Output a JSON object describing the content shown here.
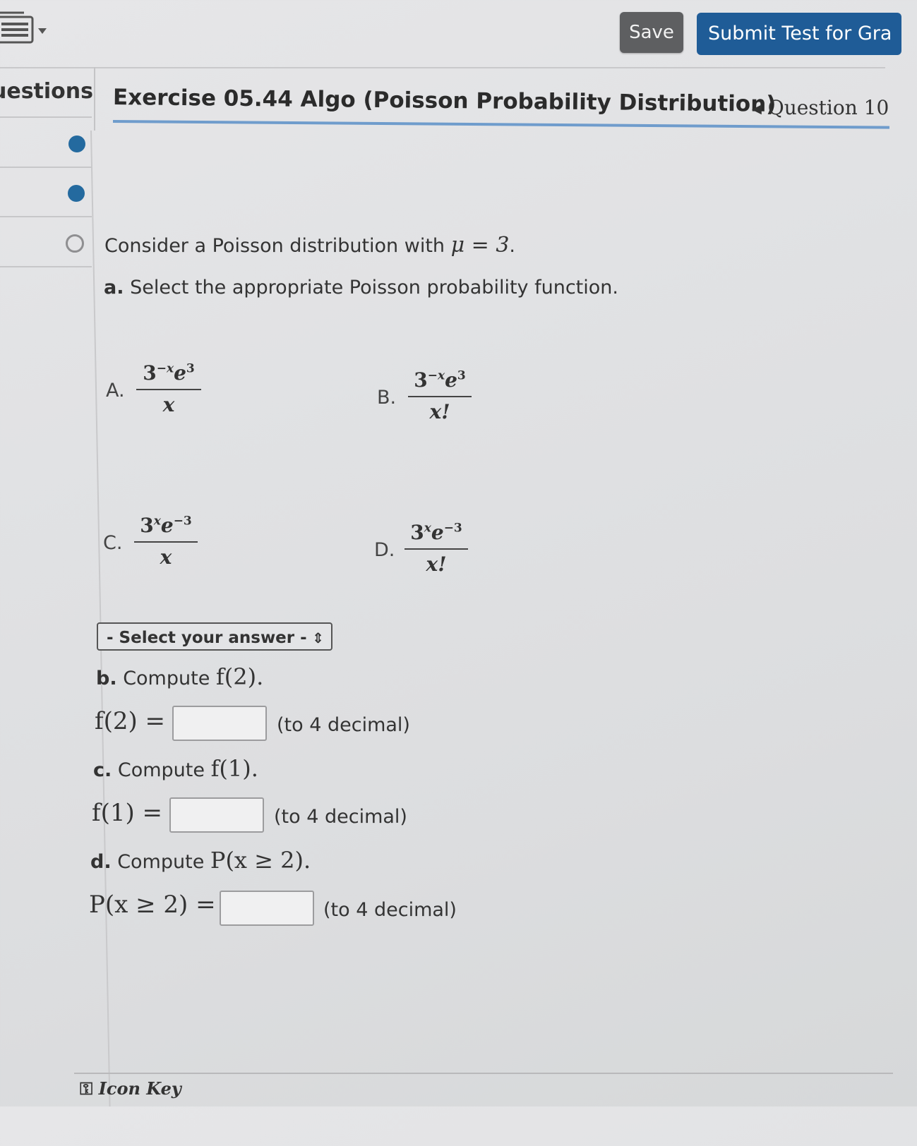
{
  "toolbar": {
    "save_label": "Save",
    "submit_label": "Submit Test for Gra"
  },
  "sidebar": {
    "header": "uestions",
    "items": [
      {
        "status": "answered"
      },
      {
        "status": "answered"
      },
      {
        "status": "unanswered"
      }
    ]
  },
  "exercise": {
    "title": "Exercise 05.44 Algo (Poisson Probability Distribution)",
    "nav_label": "Question 10"
  },
  "question": {
    "intro_text": "Consider a Poisson distribution with ",
    "intro_math": "μ = 3",
    "intro_end": ".",
    "part_a_label": "a.",
    "part_a_text": "Select the appropriate Poisson probability function.",
    "options": [
      {
        "letter": "A.",
        "num_base": "3",
        "num_exp1": "−x",
        "num_e": "e",
        "num_exp2": "3",
        "den": "x"
      },
      {
        "letter": "B.",
        "num_base": "3",
        "num_exp1": "−x",
        "num_e": "e",
        "num_exp2": "3",
        "den": "x!"
      },
      {
        "letter": "C.",
        "num_base": "3",
        "num_exp1": "x",
        "num_e": "e",
        "num_exp2": "−3",
        "den": "x"
      },
      {
        "letter": "D.",
        "num_base": "3",
        "num_exp1": "x",
        "num_e": "e",
        "num_exp2": "−3",
        "den": "x!"
      }
    ],
    "select_placeholder": "- Select your answer -",
    "part_b_label": "b.",
    "part_b_text": "Compute ",
    "part_b_math": "f(2).",
    "part_b_eq": "f(2) =",
    "part_c_label": "c.",
    "part_c_text": "Compute ",
    "part_c_math": "f(1).",
    "part_c_eq": "f(1) =",
    "part_d_label": "d.",
    "part_d_text": "Compute ",
    "part_d_math": "P(x ≥ 2).",
    "part_d_eq": "P(x ≥ 2) =",
    "decimal_hint": "(to 4 decimal)"
  },
  "footer": {
    "icon_key_label": "Icon Key"
  }
}
